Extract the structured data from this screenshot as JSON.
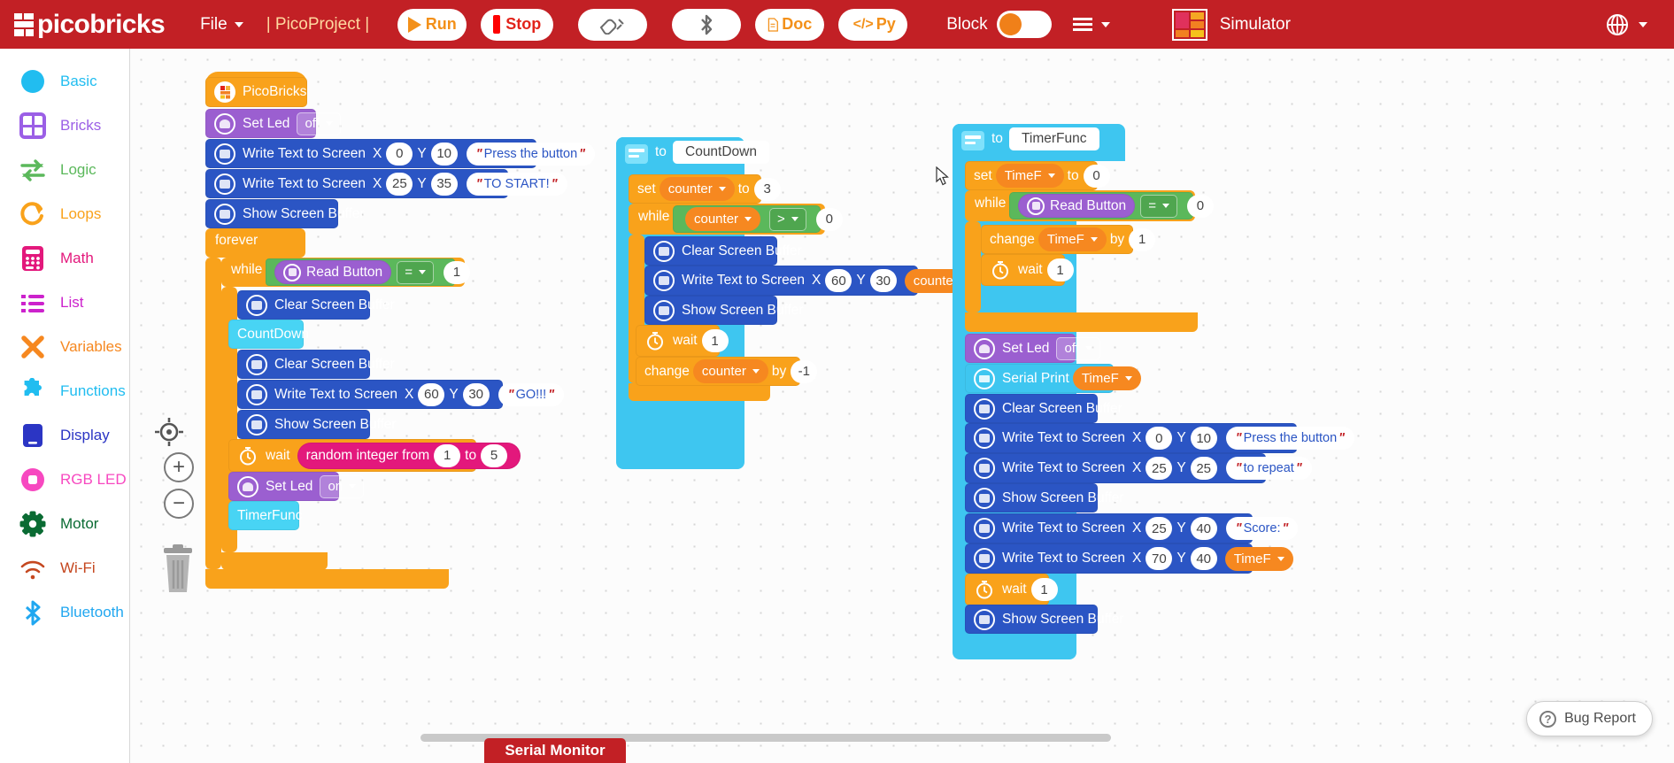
{
  "header": {
    "brand": "picobricks",
    "brand_icon": "picobricks-logo-icon",
    "file_menu": "File",
    "project_name": "| PicoProject |",
    "run_label": "Run",
    "stop_label": "Stop",
    "connect_icon": "usb-connect-icon",
    "bluetooth_icon": "bluetooth-icon",
    "doc_label": "Doc",
    "py_label": "Py",
    "py_icon": "code-brackets-icon",
    "doc_icon": "document-icon",
    "mode_label": "Block",
    "mode_toggle_state": "on",
    "menu_icon": "hamburger-menu-icon",
    "simulator_label": "Simulator",
    "simulator_icon": "simulator-grid-icon",
    "language_icon": "globe-icon",
    "accent_red": "#c22025",
    "accent_orange": "#f39019"
  },
  "sidebar": {
    "items": [
      {
        "label": "Basic",
        "icon": "circle-icon",
        "color": "#21bdf0"
      },
      {
        "label": "Bricks",
        "icon": "grid-icon",
        "color": "#9b5fe6"
      },
      {
        "label": "Logic",
        "icon": "arrows-icon",
        "color": "#5bb85b"
      },
      {
        "label": "Loops",
        "icon": "refresh-icon",
        "color": "#f9a21b"
      },
      {
        "label": "Math",
        "icon": "calculator-icon",
        "color": "#e3187c"
      },
      {
        "label": "List",
        "icon": "list-icon",
        "color": "#cc22cc"
      },
      {
        "label": "Variables",
        "icon": "x-cross-icon",
        "color": "#f68820"
      },
      {
        "label": "Functions",
        "icon": "puzzle-icon",
        "color": "#21bdf0"
      },
      {
        "label": "Display",
        "icon": "screen-icon",
        "color": "#2b35c4"
      },
      {
        "label": "RGB LED",
        "icon": "led-icon",
        "color": "#f748c0"
      },
      {
        "label": "Motor",
        "icon": "gear-icon",
        "color": "#0a6b33"
      },
      {
        "label": "Wi-Fi",
        "icon": "wifi-icon",
        "color": "#c5471f"
      },
      {
        "label": "Bluetooth",
        "icon": "bluetooth-icon",
        "color": "#21a7f0"
      }
    ]
  },
  "canvas": {
    "zoom_center_icon": "center-target-icon",
    "zoom_in_label": "+",
    "zoom_out_label": "−",
    "trash_icon": "trash-icon",
    "cursor_icon": "mouse-pointer-icon"
  },
  "program": {
    "main_stack": {
      "hat_label": "PicoBricks",
      "hat_icon": "picobricks-chip-icon",
      "blocks": [
        {
          "label": "Set Led",
          "dropdown": "off",
          "icon": "led-bulb-icon",
          "color": "purple"
        },
        {
          "label": "Write Text to Screen",
          "x_label": "X",
          "x": "0",
          "y_label": "Y",
          "y": "10",
          "text": "Press the button",
          "icon": "screen-icon",
          "color": "blue"
        },
        {
          "label": "Write Text to Screen",
          "x_label": "X",
          "x": "25",
          "y_label": "Y",
          "y": "35",
          "text": "TO START!",
          "icon": "screen-icon",
          "color": "blue"
        },
        {
          "label": "Show Screen Buffer",
          "icon": "screen-icon",
          "color": "blue"
        }
      ],
      "forever_label": "forever",
      "while_label": "while",
      "while_condition": {
        "block": "Read Button",
        "icon": "button-icon",
        "operator": "=",
        "value": "1"
      },
      "while_body": [
        {
          "label": "Clear Screen Buffer",
          "icon": "screen-icon",
          "color": "blue"
        },
        {
          "label": "CountDown",
          "color": "cyanL",
          "type": "call"
        },
        {
          "label": "Clear Screen Buffer",
          "icon": "screen-icon",
          "color": "blue"
        },
        {
          "label": "Write Text to Screen",
          "x_label": "X",
          "x": "60",
          "y_label": "Y",
          "y": "30",
          "text": "GO!!!",
          "icon": "screen-icon",
          "color": "blue"
        },
        {
          "label": "Show Screen Buffer",
          "icon": "screen-icon",
          "color": "blue"
        },
        {
          "label": "wait",
          "icon": "timer-icon",
          "color": "orange",
          "random": {
            "label": "random integer from",
            "from": "1",
            "to_label": "to",
            "to": "5"
          }
        },
        {
          "label": "Set Led",
          "dropdown": "on",
          "icon": "led-bulb-icon",
          "color": "purple"
        },
        {
          "label": "TimerFunc",
          "color": "cyanL",
          "type": "call"
        }
      ]
    },
    "countdown_function": {
      "to_label": "to",
      "name": "CountDown",
      "header_icon": "function-icon",
      "set_label": "set",
      "set_var": "counter",
      "set_to_label": "to",
      "set_value": "3",
      "while_label": "while",
      "while_var": "counter",
      "while_op": ">",
      "while_value": "0",
      "body": [
        {
          "label": "Clear Screen Buffer",
          "icon": "screen-icon",
          "color": "blue"
        },
        {
          "label": "Write Text to Screen",
          "x_label": "X",
          "x": "60",
          "y_label": "Y",
          "y": "30",
          "var": "counter",
          "icon": "screen-icon",
          "color": "blue"
        },
        {
          "label": "Show Screen Buffer",
          "icon": "screen-icon",
          "color": "blue"
        },
        {
          "label": "wait",
          "icon": "timer-icon",
          "color": "orange",
          "value": "1"
        }
      ],
      "change_label": "change",
      "change_var": "counter",
      "change_by_label": "by",
      "change_value": "-1"
    },
    "timer_function": {
      "to_label": "to",
      "name": "TimerFunc",
      "header_icon": "function-icon",
      "set_label": "set",
      "set_var": "TimeF",
      "set_to_label": "to",
      "set_value": "0",
      "while_label": "while",
      "while_block": "Read Button",
      "while_icon": "button-icon",
      "while_op": "=",
      "while_value": "0",
      "change_label": "change",
      "change_var": "TimeF",
      "change_by_label": "by",
      "change_value": "1",
      "wait_label": "wait",
      "wait_value": "1",
      "after": [
        {
          "label": "Set Led",
          "dropdown": "off",
          "icon": "led-bulb-icon",
          "color": "purple"
        },
        {
          "label": "Serial Print",
          "var": "TimeF",
          "icon": "serial-icon",
          "color": "cyan"
        },
        {
          "label": "Clear Screen Buffer",
          "icon": "screen-icon",
          "color": "blue"
        },
        {
          "label": "Write Text to Screen",
          "x_label": "X",
          "x": "0",
          "y_label": "Y",
          "y": "10",
          "text": "Press the button",
          "icon": "screen-icon",
          "color": "blue"
        },
        {
          "label": "Write Text to Screen",
          "x_label": "X",
          "x": "25",
          "y_label": "Y",
          "y": "25",
          "text": "to repeat",
          "icon": "screen-icon",
          "color": "blue"
        },
        {
          "label": "Show Screen Buffer",
          "icon": "screen-icon",
          "color": "blue"
        },
        {
          "label": "Write Text to Screen",
          "x_label": "X",
          "x": "25",
          "y_label": "Y",
          "y": "40",
          "text": "Score: ",
          "icon": "screen-icon",
          "color": "blue"
        },
        {
          "label": "Write Text to Screen",
          "x_label": "X",
          "x": "70",
          "y_label": "Y",
          "y": "40",
          "var": "TimeF",
          "icon": "screen-icon",
          "color": "blue"
        },
        {
          "label": "wait",
          "icon": "timer-icon",
          "color": "orange",
          "value": "1"
        },
        {
          "label": "Show Screen Buffer",
          "icon": "screen-icon",
          "color": "blue"
        }
      ]
    }
  },
  "footer": {
    "serial_monitor_label": "Serial Monitor",
    "bug_report_label": "Bug Report",
    "bug_report_icon": "question-circle-icon",
    "scrollbar": "horizontal-scrollbar"
  }
}
